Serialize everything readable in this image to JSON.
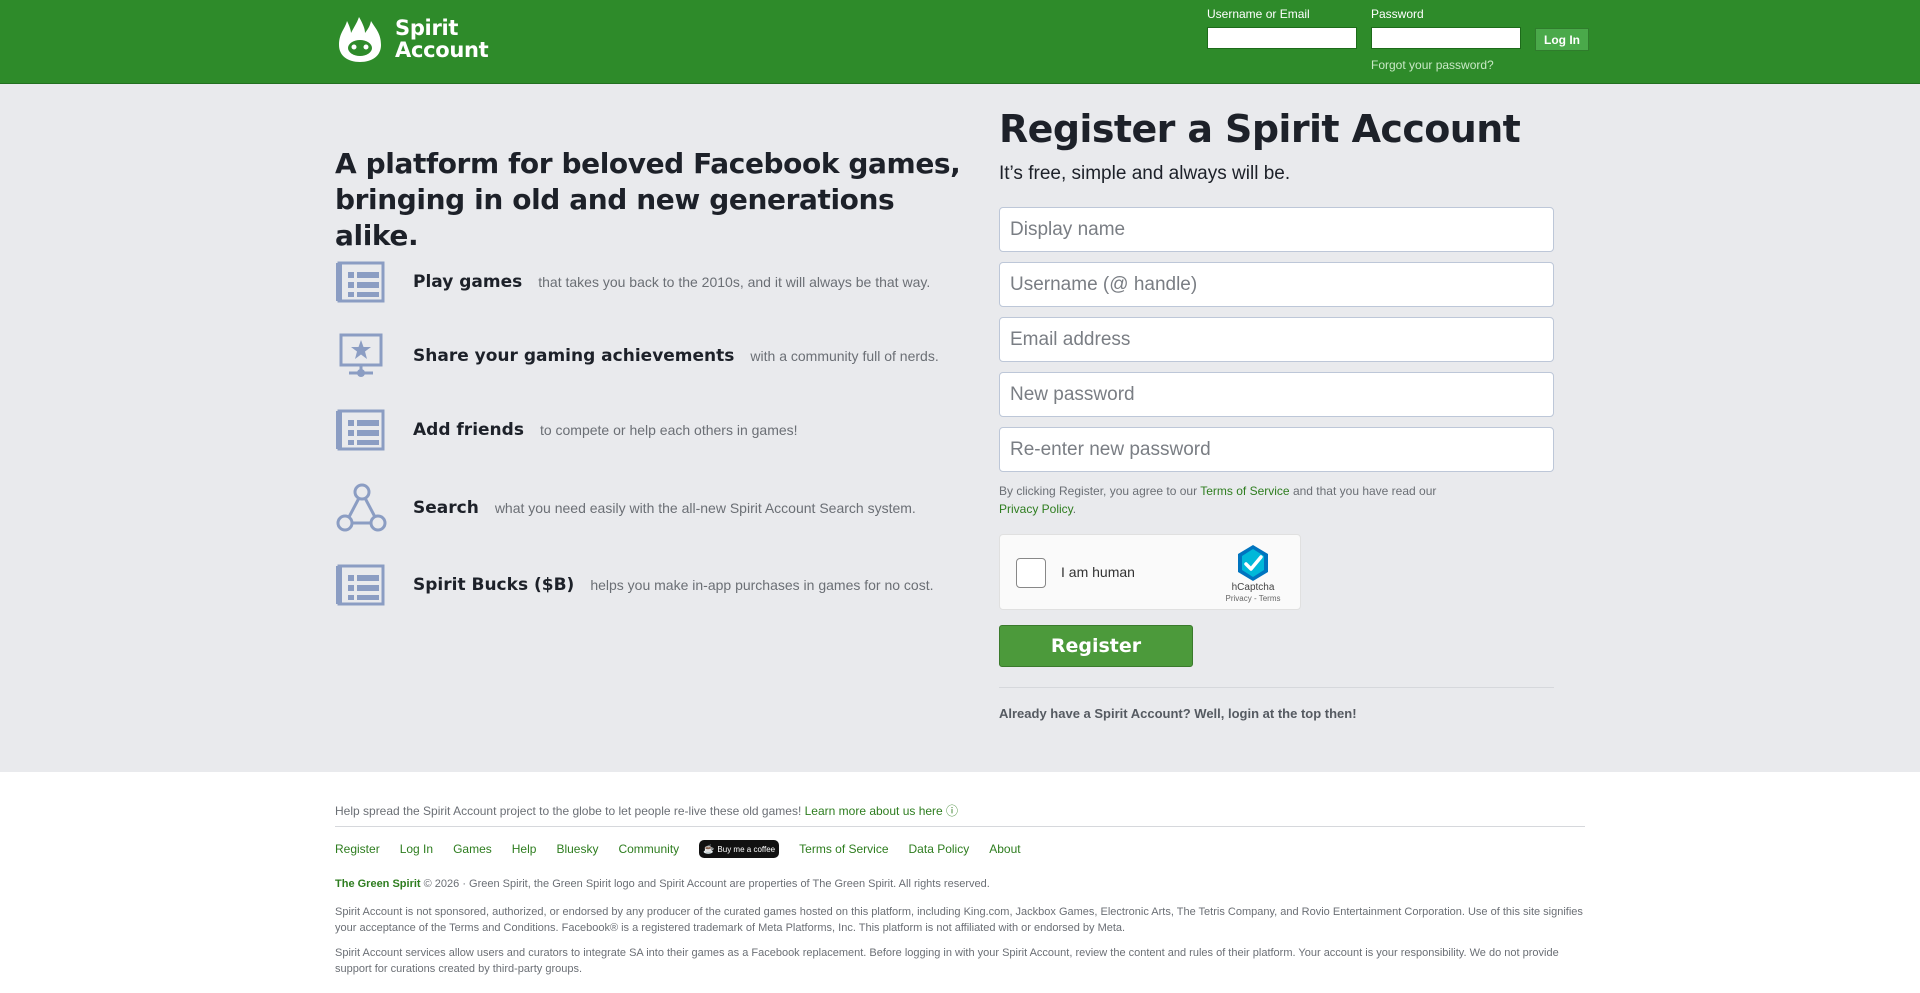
{
  "header": {
    "logo_line1": "Spirit",
    "logo_line2": "Account",
    "username_label": "Username or Email",
    "password_label": "Password",
    "login_button": "Log In",
    "forgot_password": "Forgot your password?"
  },
  "intro": {
    "tagline": "A platform for beloved Facebook games, bringing in old and new generations alike.",
    "features": [
      {
        "title": "Play games",
        "desc": "that takes you back to the 2010s, and it will always be that way.",
        "icon": "list-icon"
      },
      {
        "title": "Share your gaming achievements",
        "desc": "with a community full of nerds.",
        "icon": "monitor-star-icon"
      },
      {
        "title": "Add friends",
        "desc": "to compete or help each others in games!",
        "icon": "list-icon"
      },
      {
        "title": "Search",
        "desc": "what you need easily with the all-new Spirit Account Search system.",
        "icon": "network-icon"
      },
      {
        "title": "Spirit Bucks ($B)",
        "desc": "helps you make in-app purchases in games for no cost.",
        "icon": "list-icon"
      }
    ]
  },
  "register": {
    "title": "Register a Spirit Account",
    "subtitle": "It’s free, simple and always will be.",
    "fields": {
      "display_name": "Display name",
      "username": "Username (@ handle)",
      "email": "Email address",
      "new_password": "New password",
      "reenter_password": "Re-enter new password"
    },
    "terms_prefix": "By clicking Register, you agree to our",
    "terms_link": "Terms of Service",
    "terms_middle": "and that you have read our",
    "privacy_link": "Privacy Policy",
    "terms_suffix": ".",
    "captcha_label": "I am human",
    "captcha_brand": "hCaptcha",
    "captcha_links": "Privacy - Terms",
    "register_button": "Register",
    "already": "Already have a Spirit Account? Well, login at the top then!"
  },
  "footer": {
    "promo_text": "Help spread the Spirit Account project to the globe to let people re-live these old games!",
    "promo_link": "Learn more about us here ⓘ",
    "nav": [
      "Register",
      "Log In",
      "Games",
      "Help",
      "Bluesky",
      "Community"
    ],
    "coffee": "Buy me a coffee",
    "nav_after": [
      "Terms of Service",
      "Data Policy",
      "About"
    ],
    "copyright_brand": "The Green Spirit",
    "copyright_text": "© 2026 · Green Spirit, the Green Spirit logo and Spirit Account are properties of The Green Spirit. All rights reserved.",
    "disclaimer1": "Spirit Account is not sponsored, authorized, or endorsed by any producer of the curated games hosted on this platform, including King.com, Jackbox Games, Electronic Arts, The Tetris Company, and Rovio Entertainment Corporation. Use of this site signifies your acceptance of the Terms and Conditions. Facebook® is a registered trademark of Meta Platforms, Inc. This platform is not affiliated with or endorsed by Meta.",
    "disclaimer2": "Spirit Account services allow users and curators to integrate SA into their games as a Facebook replacement. Before logging in with your Spirit Account, review the content and rules of their platform. Your account is your responsibility. We do not provide support for curations created by third-party groups."
  },
  "colors": {
    "brand_green": "#2e8b2a",
    "link_green": "#2e7d1f",
    "register_green": "#4c9a3b",
    "icon_blue": "#8b9dc3"
  }
}
